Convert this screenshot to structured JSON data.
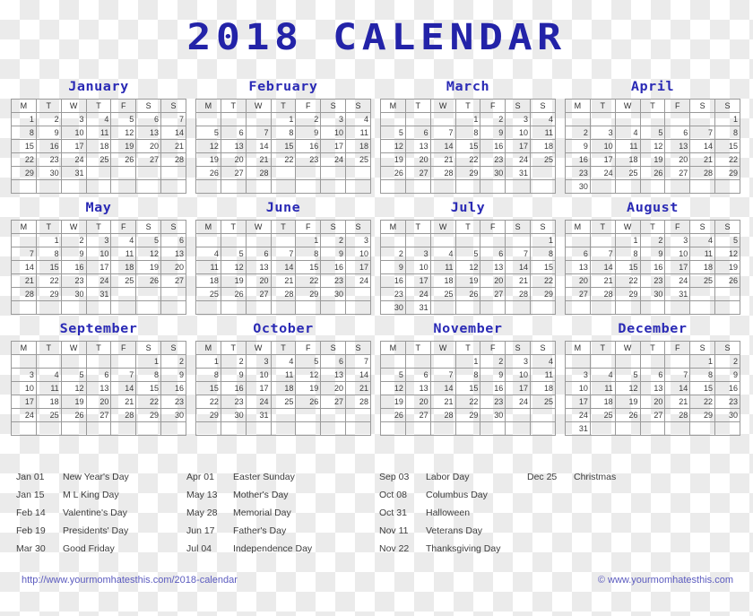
{
  "header": {
    "title": "2018 CALENDAR",
    "title_color": "#2323a8"
  },
  "weekday_headers": [
    "M",
    "T",
    "W",
    "T",
    "F",
    "S",
    "S"
  ],
  "months": [
    {
      "name": "January",
      "weeks": [
        [
          "1",
          "2",
          "3",
          "4",
          "5",
          "6",
          "7"
        ],
        [
          "8",
          "9",
          "10",
          "11",
          "12",
          "13",
          "14"
        ],
        [
          "15",
          "16",
          "17",
          "18",
          "19",
          "20",
          "21"
        ],
        [
          "22",
          "23",
          "24",
          "25",
          "26",
          "27",
          "28"
        ],
        [
          "29",
          "30",
          "31",
          "",
          "",
          "",
          ""
        ],
        [
          "",
          "",
          "",
          "",
          "",
          "",
          ""
        ]
      ]
    },
    {
      "name": "February",
      "weeks": [
        [
          "",
          "",
          "",
          "1",
          "2",
          "3",
          "4"
        ],
        [
          "5",
          "6",
          "7",
          "8",
          "9",
          "10",
          "11"
        ],
        [
          "12",
          "13",
          "14",
          "15",
          "16",
          "17",
          "18"
        ],
        [
          "19",
          "20",
          "21",
          "22",
          "23",
          "24",
          "25"
        ],
        [
          "26",
          "27",
          "28",
          "",
          "",
          "",
          ""
        ],
        [
          "",
          "",
          "",
          "",
          "",
          "",
          ""
        ]
      ]
    },
    {
      "name": "March",
      "weeks": [
        [
          "",
          "",
          "",
          "1",
          "2",
          "3",
          "4"
        ],
        [
          "5",
          "6",
          "7",
          "8",
          "9",
          "10",
          "11"
        ],
        [
          "12",
          "13",
          "14",
          "15",
          "16",
          "17",
          "18"
        ],
        [
          "19",
          "20",
          "21",
          "22",
          "23",
          "24",
          "25"
        ],
        [
          "26",
          "27",
          "28",
          "29",
          "30",
          "31",
          ""
        ],
        [
          "",
          "",
          "",
          "",
          "",
          "",
          ""
        ]
      ]
    },
    {
      "name": "April",
      "weeks": [
        [
          "",
          "",
          "",
          "",
          "",
          "",
          "1"
        ],
        [
          "2",
          "3",
          "4",
          "5",
          "6",
          "7",
          "8"
        ],
        [
          "9",
          "10",
          "11",
          "12",
          "13",
          "14",
          "15"
        ],
        [
          "16",
          "17",
          "18",
          "19",
          "20",
          "21",
          "22"
        ],
        [
          "23",
          "24",
          "25",
          "26",
          "27",
          "28",
          "29"
        ],
        [
          "30",
          "",
          "",
          "",
          "",
          "",
          ""
        ]
      ]
    },
    {
      "name": "May",
      "weeks": [
        [
          "",
          "1",
          "2",
          "3",
          "4",
          "5",
          "6"
        ],
        [
          "7",
          "8",
          "9",
          "10",
          "11",
          "12",
          "13"
        ],
        [
          "14",
          "15",
          "16",
          "17",
          "18",
          "19",
          "20"
        ],
        [
          "21",
          "22",
          "23",
          "24",
          "25",
          "26",
          "27"
        ],
        [
          "28",
          "29",
          "30",
          "31",
          "",
          "",
          ""
        ],
        [
          "",
          "",
          "",
          "",
          "",
          "",
          ""
        ]
      ]
    },
    {
      "name": "June",
      "weeks": [
        [
          "",
          "",
          "",
          "",
          "1",
          "2",
          "3"
        ],
        [
          "4",
          "5",
          "6",
          "7",
          "8",
          "9",
          "10"
        ],
        [
          "11",
          "12",
          "13",
          "14",
          "15",
          "16",
          "17"
        ],
        [
          "18",
          "19",
          "20",
          "21",
          "22",
          "23",
          "24"
        ],
        [
          "25",
          "26",
          "27",
          "28",
          "29",
          "30",
          ""
        ],
        [
          "",
          "",
          "",
          "",
          "",
          "",
          ""
        ]
      ]
    },
    {
      "name": "July",
      "weeks": [
        [
          "",
          "",
          "",
          "",
          "",
          "",
          "1"
        ],
        [
          "2",
          "3",
          "4",
          "5",
          "6",
          "7",
          "8"
        ],
        [
          "9",
          "10",
          "11",
          "12",
          "13",
          "14",
          "15"
        ],
        [
          "16",
          "17",
          "18",
          "19",
          "20",
          "21",
          "22"
        ],
        [
          "23",
          "24",
          "25",
          "26",
          "27",
          "28",
          "29"
        ],
        [
          "30",
          "31",
          "",
          "",
          "",
          "",
          ""
        ]
      ]
    },
    {
      "name": "August",
      "weeks": [
        [
          "",
          "",
          "1",
          "2",
          "3",
          "4",
          "5"
        ],
        [
          "6",
          "7",
          "8",
          "9",
          "10",
          "11",
          "12"
        ],
        [
          "13",
          "14",
          "15",
          "16",
          "17",
          "18",
          "19"
        ],
        [
          "20",
          "21",
          "22",
          "23",
          "24",
          "25",
          "26"
        ],
        [
          "27",
          "28",
          "29",
          "30",
          "31",
          "",
          ""
        ],
        [
          "",
          "",
          "",
          "",
          "",
          "",
          ""
        ]
      ]
    },
    {
      "name": "September",
      "weeks": [
        [
          "",
          "",
          "",
          "",
          "",
          "1",
          "2"
        ],
        [
          "3",
          "4",
          "5",
          "6",
          "7",
          "8",
          "9"
        ],
        [
          "10",
          "11",
          "12",
          "13",
          "14",
          "15",
          "16"
        ],
        [
          "17",
          "18",
          "19",
          "20",
          "21",
          "22",
          "23"
        ],
        [
          "24",
          "25",
          "26",
          "27",
          "28",
          "29",
          "30"
        ],
        [
          "",
          "",
          "",
          "",
          "",
          "",
          ""
        ]
      ]
    },
    {
      "name": "October",
      "weeks": [
        [
          "1",
          "2",
          "3",
          "4",
          "5",
          "6",
          "7"
        ],
        [
          "8",
          "9",
          "10",
          "11",
          "12",
          "13",
          "14"
        ],
        [
          "15",
          "16",
          "17",
          "18",
          "19",
          "20",
          "21"
        ],
        [
          "22",
          "23",
          "24",
          "25",
          "26",
          "27",
          "28"
        ],
        [
          "29",
          "30",
          "31",
          "",
          "",
          "",
          ""
        ],
        [
          "",
          "",
          "",
          "",
          "",
          "",
          ""
        ]
      ]
    },
    {
      "name": "November",
      "weeks": [
        [
          "",
          "",
          "",
          "1",
          "2",
          "3",
          "4"
        ],
        [
          "5",
          "6",
          "7",
          "8",
          "9",
          "10",
          "11"
        ],
        [
          "12",
          "13",
          "14",
          "15",
          "16",
          "17",
          "18"
        ],
        [
          "19",
          "20",
          "21",
          "22",
          "23",
          "24",
          "25"
        ],
        [
          "26",
          "27",
          "28",
          "29",
          "30",
          "",
          ""
        ],
        [
          "",
          "",
          "",
          "",
          "",
          "",
          ""
        ]
      ]
    },
    {
      "name": "December",
      "weeks": [
        [
          "",
          "",
          "",
          "",
          "",
          "1",
          "2"
        ],
        [
          "3",
          "4",
          "5",
          "6",
          "7",
          "8",
          "9"
        ],
        [
          "10",
          "11",
          "12",
          "13",
          "14",
          "15",
          "16"
        ],
        [
          "17",
          "18",
          "19",
          "20",
          "21",
          "22",
          "23"
        ],
        [
          "24",
          "25",
          "26",
          "27",
          "28",
          "29",
          "30"
        ],
        [
          "31",
          "",
          "",
          "",
          "",
          "",
          ""
        ]
      ]
    }
  ],
  "holiday_columns": [
    [
      {
        "date": "Jan 01",
        "name": "New Year's Day"
      },
      {
        "date": "Jan 15",
        "name": "M L King Day"
      },
      {
        "date": "Feb 14",
        "name": "Valentine's Day"
      },
      {
        "date": "Feb 19",
        "name": "Presidents' Day"
      },
      {
        "date": "Mar 30",
        "name": "Good Friday"
      }
    ],
    [
      {
        "date": "Apr 01",
        "name": "Easter Sunday"
      },
      {
        "date": "May 13",
        "name": "Mother's Day"
      },
      {
        "date": "May 28",
        "name": "Memorial Day"
      },
      {
        "date": "Jun 17",
        "name": "Father's Day"
      },
      {
        "date": "Jul 04",
        "name": "Independence Day"
      }
    ],
    [
      {
        "date": "Sep 03",
        "name": "Labor Day"
      },
      {
        "date": "Oct 08",
        "name": "Columbus Day"
      },
      {
        "date": "Oct 31",
        "name": "Halloween"
      },
      {
        "date": "Nov 11",
        "name": "Veterans Day"
      },
      {
        "date": "Nov 22",
        "name": "Thanksgiving Day"
      }
    ],
    [
      {
        "date": "Dec 25",
        "name": "Christmas"
      }
    ]
  ],
  "footer": {
    "left_link": "http://www.yourmomhatesthis.com/2018-calendar",
    "right_text": "© www.yourmomhatesthis.com",
    "link_color": "#5b5bbf"
  }
}
